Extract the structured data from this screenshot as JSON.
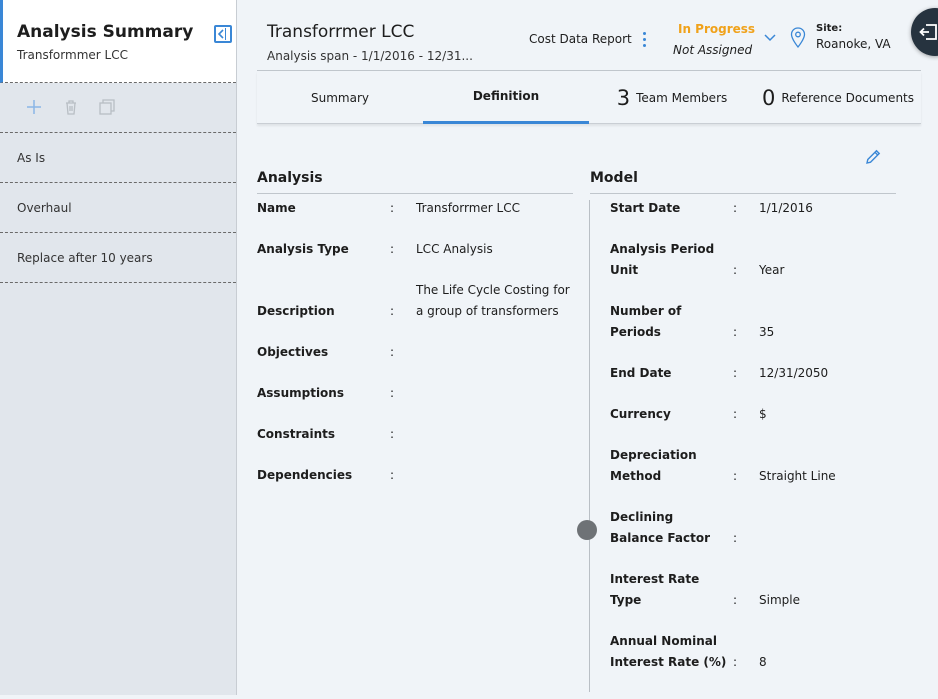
{
  "sidebar": {
    "title": "Analysis Summary",
    "subtitle": "Transformmer LCC",
    "items": [
      {
        "label": "As Is"
      },
      {
        "label": "Overhaul"
      },
      {
        "label": "Replace after 10 years"
      }
    ]
  },
  "header": {
    "title": "Transforrmer LCC",
    "span": "Analysis span - 1/1/2016 - 12/31...",
    "report_label": "Cost Data Report",
    "status": "In Progress",
    "assignment": "Not Assigned",
    "site_label": "Site:",
    "site_value": "Roanoke, VA"
  },
  "tabs": [
    {
      "label": "Summary"
    },
    {
      "label": "Definition"
    },
    {
      "count": "3",
      "label": "Team Members"
    },
    {
      "count": "0",
      "label": "Reference Documents"
    }
  ],
  "analysis": {
    "title": "Analysis",
    "fields": [
      {
        "label": "Name",
        "value": "Transforrmer LCC"
      },
      {
        "label": "Analysis Type",
        "value": "LCC Analysis"
      },
      {
        "label": "Description",
        "value_line1": "The Life Cycle Costing for",
        "value_line2": "a group of transformers"
      },
      {
        "label": "Objectives",
        "value": ""
      },
      {
        "label": "Assumptions",
        "value": ""
      },
      {
        "label": "Constraints",
        "value": ""
      },
      {
        "label": "Dependencies",
        "value": ""
      }
    ]
  },
  "model": {
    "title": "Model",
    "fields": [
      {
        "label": "Start Date",
        "value": "1/1/2016"
      },
      {
        "label_line1": "Analysis Period",
        "label_line2": "Unit",
        "value": "Year"
      },
      {
        "label_line1": "Number of",
        "label_line2": "Periods",
        "value": "35"
      },
      {
        "label": "End Date",
        "value": "12/31/2050"
      },
      {
        "label": "Currency",
        "value": "$"
      },
      {
        "label_line1": "Depreciation",
        "label_line2": "Method",
        "value": "Straight Line"
      },
      {
        "label_line1": "Declining",
        "label_line2": "Balance Factor",
        "value": ""
      },
      {
        "label_line1": "Interest Rate",
        "label_line2": "Type",
        "value": "Simple"
      },
      {
        "label_line1": "Annual Nominal",
        "label_line2": "Interest Rate (%)",
        "value": "8"
      }
    ]
  },
  "colon": ":",
  "colors": {
    "accent": "#3a87d6",
    "status": "#f0a21b",
    "sidebar_bg": "#e1e6ec",
    "content_bg": "#f0f4f8"
  },
  "icons": [
    "collapse-panel-icon",
    "add-icon",
    "delete-icon",
    "copy-icon",
    "kebab-menu-icon",
    "chevron-down-icon",
    "location-pin-icon",
    "edit-pencil-icon",
    "exit-icon"
  ]
}
